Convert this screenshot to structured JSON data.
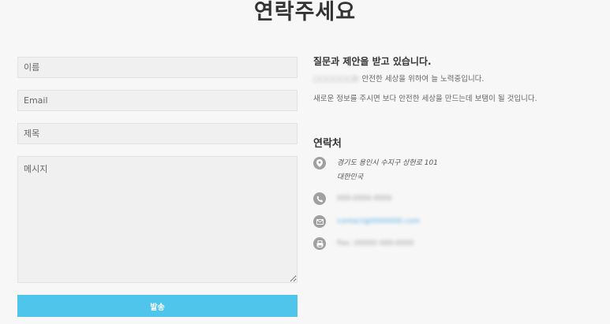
{
  "page": {
    "title": "연락주세요"
  },
  "form": {
    "name_placeholder": "이름",
    "email_placeholder": "Email",
    "subject_placeholder": "제목",
    "message_placeholder": "메시지",
    "submit_label": "발송"
  },
  "info": {
    "title": "질문과 제안을 받고 있습니다.",
    "line1_redacted": "○○○○○○는",
    "line1_text": " 안전한 세상을 위하여 늘 노력중입니다.",
    "line2_text": "새로운 정보를 주시면 보다 안전한 세상을 만드는데 보탬이 될 것입니다."
  },
  "contact": {
    "title": "연락처",
    "address_line1": "경기도 용인시 수지구 상현로 101",
    "address_line2": "대한민국",
    "phone_redacted": "000-0000-0000",
    "email_redacted": "contact@0000000.com",
    "fax_redacted": "Fax: (0000) 000-0000"
  },
  "colors": {
    "submit_button": "#4fc5ec",
    "icon_circle": "#a0a0a0",
    "background": "#f7f7f7",
    "link": "#5aaee8"
  },
  "icons": {
    "address": "map-pin-icon",
    "phone": "phone-icon",
    "email": "mail-icon",
    "fax": "fax-icon"
  }
}
